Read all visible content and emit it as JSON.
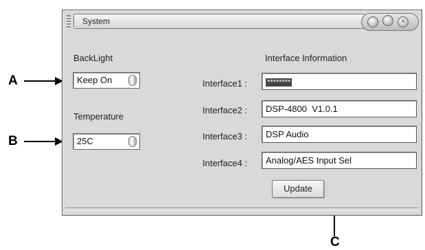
{
  "callouts": {
    "a": "A",
    "b": "B",
    "c": "C"
  },
  "window": {
    "title": "System",
    "caption_icons": [
      "minimize-icon",
      "maximize-icon",
      "close-icon"
    ]
  },
  "backlight": {
    "label": "BackLight",
    "value": "Keep On"
  },
  "temperature": {
    "label": "Temperature",
    "value": "25C"
  },
  "interface_info": {
    "heading": "Interface Information",
    "rows": [
      {
        "label": "Interface1 :",
        "value": "********"
      },
      {
        "label": "Interface2 :",
        "value": "DSP-4800  V1.0.1"
      },
      {
        "label": "Interface3 :",
        "value": "DSP Audio"
      },
      {
        "label": "Interface4 :",
        "value": "Analog/AES Input Sel"
      }
    ]
  },
  "update_label": "Update"
}
